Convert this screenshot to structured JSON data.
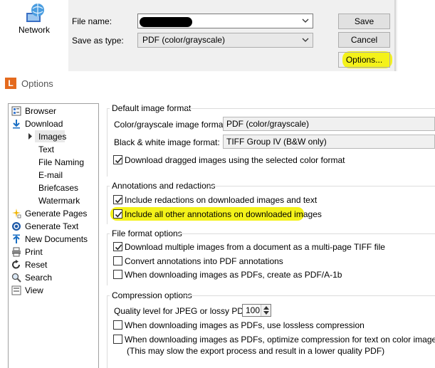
{
  "save_dialog": {
    "network_label": "Network",
    "file_name_label": "File name:",
    "file_name_value": "",
    "save_as_type_label": "Save as type:",
    "save_as_type_value": "PDF (color/grayscale)",
    "save_button": "Save",
    "cancel_button": "Cancel",
    "options_button": "Options..."
  },
  "options_window": {
    "app_icon_letter": "L",
    "title": "Options",
    "nav": {
      "items": [
        {
          "label": "Browser",
          "icon": "browser-icon"
        },
        {
          "label": "Download",
          "icon": "download-arrow-icon"
        },
        {
          "label": "Images",
          "selected": true
        },
        {
          "label": "Text"
        },
        {
          "label": "File Naming"
        },
        {
          "label": "E-mail"
        },
        {
          "label": "Briefcases"
        },
        {
          "label": "Watermark"
        },
        {
          "label": "Generate Pages",
          "icon": "sparkle-icon"
        },
        {
          "label": "Generate Text",
          "icon": "ocr-icon"
        },
        {
          "label": "New Documents",
          "icon": "upload-arrow-icon"
        },
        {
          "label": "Print",
          "icon": "printer-icon"
        },
        {
          "label": "Reset",
          "icon": "reset-icon"
        },
        {
          "label": "Search",
          "icon": "search-icon"
        },
        {
          "label": "View",
          "icon": "view-icon"
        }
      ]
    },
    "default_image_format": {
      "title": "Default image format",
      "color_label": "Color/grayscale image format:",
      "color_value": "PDF (color/grayscale)",
      "bw_label": "Black & white image format:",
      "bw_value": "TIFF Group IV (B&W only)",
      "dragged_label": "Download dragged images using the selected color format",
      "dragged_checked": true
    },
    "annotations": {
      "title": "Annotations and redactions",
      "redactions_label": "Include redactions on downloaded images and text",
      "redactions_checked": true,
      "other_label": "Include all other annotations on downloaded images",
      "other_checked": true
    },
    "file_format": {
      "title": "File format options",
      "multipage_label": "Download multiple images from a document as a multi-page TIFF file",
      "multipage_checked": true,
      "convert_label": "Convert annotations into PDF annotations",
      "convert_checked": false,
      "pdfa_label": "When downloading images as PDFs, create as PDF/A-1b",
      "pdfa_checked": false
    },
    "compression": {
      "title": "Compression options",
      "quality_label": "Quality level for JPEG or lossy PDF:",
      "quality_value": "100",
      "lossless_label": "When downloading images as PDFs, use lossless compression",
      "lossless_checked": false,
      "optimize_label": "When downloading images as PDFs, optimize compression for text on color images",
      "optimize_note": "(This may slow the export process and result in a lower quality PDF)",
      "optimize_checked": false
    }
  },
  "colors": {
    "highlight": "#f4f21a",
    "app_icon": "#e46a1e"
  }
}
